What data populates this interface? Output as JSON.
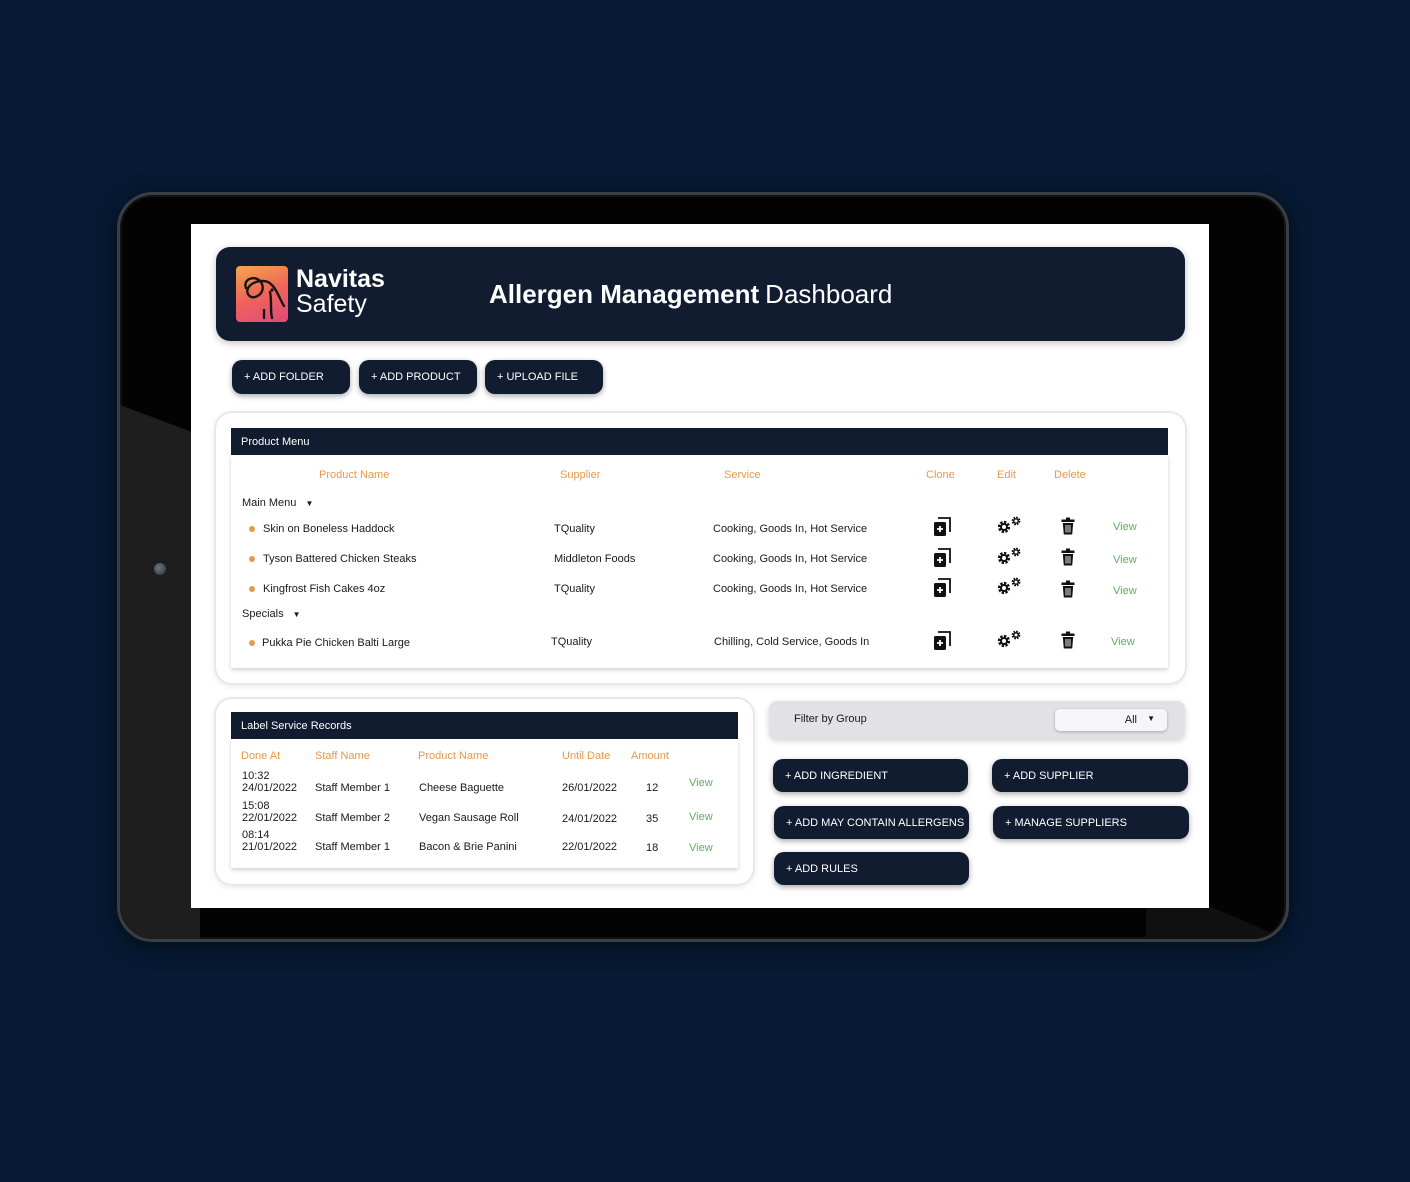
{
  "header": {
    "logo_line1": "Navitas",
    "logo_line2": "Safety",
    "title_bold": "Allergen Management",
    "title_light": "Dashboard"
  },
  "toolbar": {
    "add_folder": "+ ADD FOLDER",
    "add_product": "+ ADD PRODUCT",
    "upload_file": "+ UPLOAD FILE"
  },
  "product_menu": {
    "title": "Product Menu",
    "columns": {
      "product_name": "Product Name",
      "supplier": "Supplier",
      "service": "Service",
      "clone": "Clone",
      "edit": "Edit",
      "delete": "Delete"
    },
    "groups": [
      {
        "name": "Main Menu",
        "caret": "▼",
        "items": [
          {
            "name": "Skin on Boneless Haddock",
            "supplier": "TQuality",
            "service": "Cooking, Goods In, Hot Service",
            "view": "View"
          },
          {
            "name": "Tyson Battered Chicken Steaks",
            "supplier": "Middleton Foods",
            "service": "Cooking, Goods In, Hot Service",
            "view": "View"
          },
          {
            "name": "Kingfrost Fish Cakes 4oz",
            "supplier": "TQuality",
            "service": "Cooking, Goods In, Hot Service",
            "view": "View"
          }
        ]
      },
      {
        "name": "Specials",
        "caret": "▼",
        "items": [
          {
            "name": "Pukka Pie Chicken Balti Large",
            "supplier": "TQuality",
            "service": "Chilling, Cold Service, Goods In",
            "view": "View"
          }
        ]
      }
    ]
  },
  "label_records": {
    "title": "Label Service Records",
    "columns": {
      "done_at": "Done At",
      "staff_name": "Staff Name",
      "product_name": "Product Name",
      "until_date": "Until Date",
      "amount": "Amount"
    },
    "rows": [
      {
        "time": "10:32",
        "date": "24/01/2022",
        "staff": "Staff Member 1",
        "product": "Cheese Baguette",
        "until": "26/01/2022",
        "amount": "12",
        "view": "View"
      },
      {
        "time": "15:08",
        "date": "22/01/2022",
        "staff": "Staff Member 2",
        "product": "Vegan Sausage Roll",
        "until": "24/01/2022",
        "amount": "35",
        "view": "View"
      },
      {
        "time": "08:14",
        "date": "21/01/2022",
        "staff": "Staff Member 1",
        "product": "Bacon & Brie Panini",
        "until": "22/01/2022",
        "amount": "18",
        "view": "View"
      }
    ]
  },
  "filter": {
    "label": "Filter by Group",
    "selected": "All",
    "caret": "▼"
  },
  "actions": {
    "add_ingredient": "+ ADD INGREDIENT",
    "add_supplier": "+ ADD SUPPLIER",
    "add_may_contain": "+ ADD MAY CONTAIN ALLERGENS",
    "manage_suppliers": "+ MANAGE SUPPLIERS",
    "add_rules": "+ ADD RULES"
  },
  "colors": {
    "navy": "#111c30",
    "accent_orange": "#e49a4a",
    "view_green": "#5fae5f",
    "background": "#061a33"
  }
}
